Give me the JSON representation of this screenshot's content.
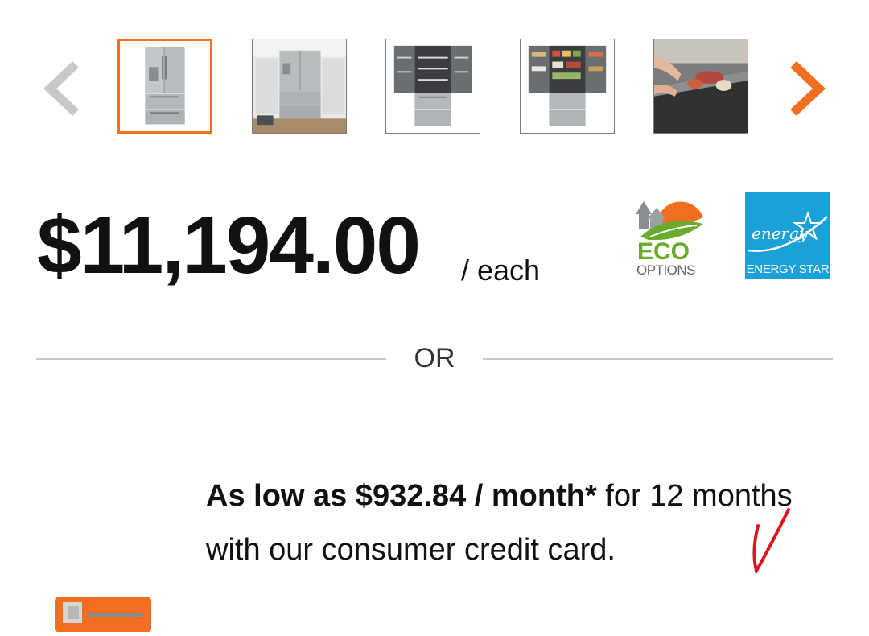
{
  "carousel": {
    "thumbnails": [
      {
        "name": "thumbnail-1",
        "selected": true,
        "alt": "fridge-front"
      },
      {
        "name": "thumbnail-2",
        "selected": false,
        "alt": "fridge-in-kitchen"
      },
      {
        "name": "thumbnail-3",
        "selected": false,
        "alt": "fridge-open-empty"
      },
      {
        "name": "thumbnail-4",
        "selected": false,
        "alt": "fridge-open-stocked"
      },
      {
        "name": "thumbnail-5",
        "selected": false,
        "alt": "drawer-with-food"
      }
    ],
    "prev_icon": "chevron-left-icon",
    "next_icon": "chevron-right-icon"
  },
  "price": {
    "amount": "$11,194.00",
    "unit": "/ each"
  },
  "badges": {
    "eco": {
      "line1": "ECO",
      "line2": "OPTIONS"
    },
    "energy_star": {
      "script": "energy",
      "label": "ENERGY STAR"
    }
  },
  "divider": {
    "label": "OR"
  },
  "financing": {
    "bold_text": "As low as $932.84 / month*",
    "text": " for 12 months with our consumer credit card."
  },
  "colors": {
    "accent": "#f26f21",
    "energy_star_blue": "#1ba0d8",
    "eco_green": "#6aab2e",
    "divider": "#c9c9c9",
    "check_mark": "#e0141e"
  }
}
